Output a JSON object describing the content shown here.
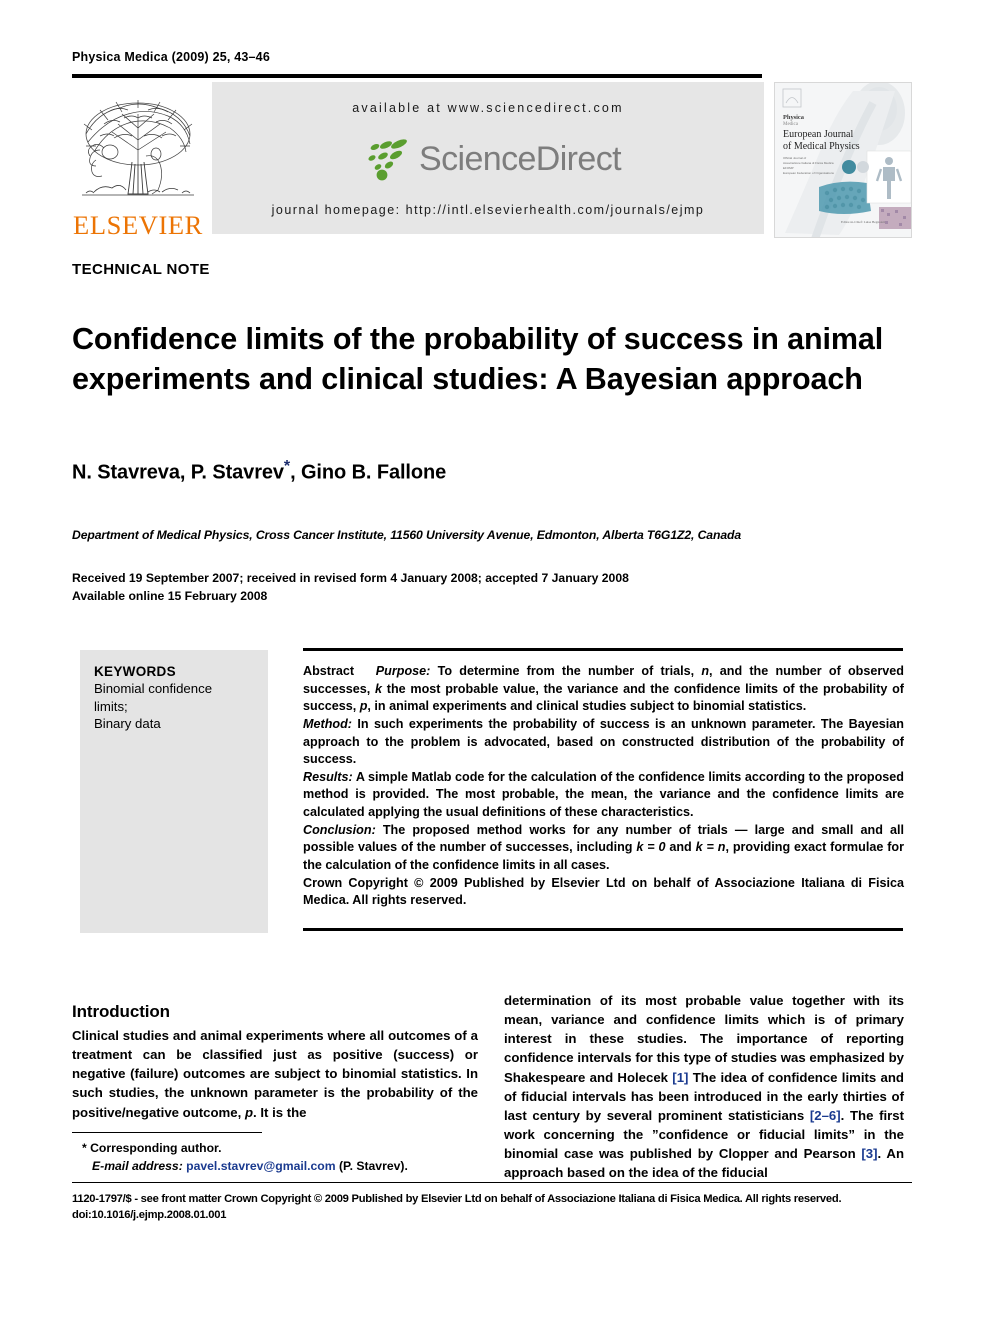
{
  "running_head": "Physica Medica (2009) 25, 43–46",
  "masthead": {
    "publisher_name": "ELSEVIER",
    "available_at": "available at www.sciencedirect.com",
    "sciencedirect_wordmark": "ScienceDirect",
    "journal_homepage": "journal homepage: http://intl.elsevierhealth.com/journals/ejmp",
    "cover": {
      "kicker": "Physica Medica",
      "title_line1": "European Journal",
      "title_line2": "of Medical Physics"
    }
  },
  "article": {
    "doctype": "TECHNICAL NOTE",
    "title": "Confidence limits of the probability of success in animal experiments and clinical studies: A Bayesian approach",
    "authors_pre": "N. Stavreva, P. Stavrev",
    "corresponding_marker": "*",
    "authors_post": ", Gino B. Fallone",
    "affiliation": "Department of Medical Physics, Cross Cancer Institute, 11560 University Avenue, Edmonton, Alberta T6G1Z2, Canada",
    "received_line": "Received 19 September 2007; received in revised form 4 January 2008; accepted 7 January 2008",
    "available_online": "Available online 15 February 2008"
  },
  "keywords": {
    "heading": "KEYWORDS",
    "items": [
      "Binomial confidence",
      "limits;",
      "Binary data"
    ]
  },
  "abstract": {
    "label": "Abstract",
    "purpose_label": "Purpose:",
    "purpose_text_a": " To determine from the number of trials, ",
    "purpose_n": "n",
    "purpose_text_b": ", and the number of observed successes, ",
    "purpose_k": "k",
    "purpose_text_c": " the most probable value, the variance and the confidence limits of the probability of success, ",
    "purpose_p": "p",
    "purpose_text_d": ", in animal experiments and clinical studies subject to binomial statistics.",
    "method_label": "Method:",
    "method_text": " In such experiments the probability of success is an unknown parameter. The Bayesian approach to the problem is advocated, based on constructed distribution of the probability of success.",
    "results_label": "Results:",
    "results_text": " A simple Matlab code for the calculation of the confidence limits according to the proposed method is provided. The most probable, the mean, the variance and the confidence limits are calculated applying the usual definitions of these characteristics.",
    "conclusion_label": "Conclusion:",
    "conclusion_text_a": " The proposed method works for any number of trials — large and small and all possible values of the number of successes, including ",
    "conclusion_k0": "k = 0",
    "conclusion_text_b": " and ",
    "conclusion_kn": "k = n",
    "conclusion_text_c": ", providing exact formulae for the calculation of the confidence limits in all cases.",
    "copyright": "Crown Copyright © 2009 Published by Elsevier Ltd on behalf of Associazione Italiana di Fisica Medica. All rights reserved."
  },
  "introduction": {
    "heading": "Introduction",
    "left_text": "Clinical studies and animal experiments where all outcomes of a treatment can be classified just as positive (success) or negative (failure) outcomes are subject to binomial statistics. In such studies, the unknown parameter is the probability of the positive/negative outcome, ",
    "left_p": "p",
    "left_tail": ". It is the",
    "right_text_a": "determination of its most probable value together with its mean, variance and confidence limits which is of primary interest in these studies. The importance of reporting confidence intervals for this type of studies was emphasized by Shakespeare and Holecek ",
    "right_ref1": "[1]",
    "right_text_b": " The idea of confidence limits and of fiducial intervals has been introduced in the early thirties of last century by several prominent statisticians ",
    "right_ref2": "[2–6]",
    "right_text_c": ". The first work concerning the ”confidence or fiducial limits” in the binomial case was published by Clopper and Pearson ",
    "right_ref3": "[3]",
    "right_text_d": ". An approach based on the idea of the fiducial"
  },
  "footnote": {
    "corresponding": "* Corresponding author.",
    "email_label": "E-mail address:",
    "email": "pavel.stavrev@gmail.com",
    "email_owner": "(P. Stavrev)."
  },
  "page_footer": {
    "line1": "1120-1797/$ - see front matter Crown Copyright © 2009 Published by Elsevier Ltd on behalf of Associazione Italiana di Fisica Medica. All rights reserved.",
    "doi": "doi:10.1016/j.ejmp.2008.01.001"
  },
  "colors": {
    "elsevier_orange": "#ec7404",
    "sciencedirect_gray": "#7d7d7d",
    "sciencedirect_green": "#5a9e2f",
    "link_blue": "#1a3a8f",
    "band_gray": "#e6e6e6",
    "keyword_gray": "#e4e4e4"
  }
}
